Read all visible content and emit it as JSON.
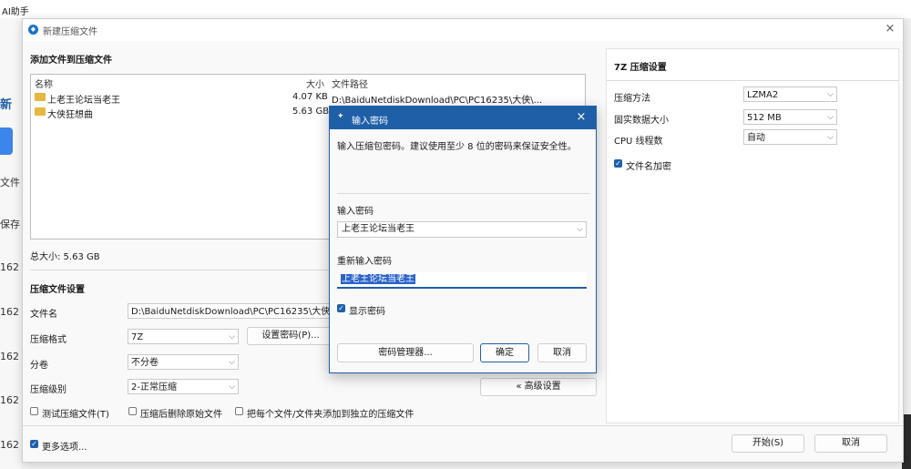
{
  "background": {
    "top_left_text": "AI助手",
    "left_texts": [
      "新",
      "文件",
      "保存",
      "162",
      "162",
      "162",
      "162",
      "162"
    ]
  },
  "window": {
    "title": "新建压缩文件",
    "close": "×",
    "add_files_label": "添加文件到压缩文件",
    "columns": {
      "name": "名称",
      "size": "大小",
      "path": "文件路径"
    },
    "files": [
      {
        "name": "上老王论坛当老王",
        "size": "4.07 KB",
        "path": "D:\\BaiduNetdiskDownload\\PC\\PC16235\\大侠\\..."
      },
      {
        "name": "大侠狂想曲",
        "size": "5.63 GB",
        "path": ""
      }
    ],
    "total_size": "总大小: 5.63 GB",
    "settings_label": "压缩文件设置",
    "filename_label": "文件名",
    "filename_value": "D:\\BaiduNetdiskDownload\\PC\\PC16235\\大侠\\大",
    "format_label": "压缩格式",
    "format_value": "7Z",
    "set_password_button": "设置密码(P)...",
    "split_label": "分卷",
    "split_value": "不分卷",
    "level_label": "压缩级别",
    "level_value": "2-正常压缩",
    "advanced_button": "« 高级设置",
    "checks": {
      "test": "测试压缩文件(T)",
      "delete": "压缩后删除原始文件",
      "each": "把每个文件/文件夹添加到独立的压缩文件",
      "more": "更多选项..."
    },
    "start_button": "开始(S)",
    "cancel_button": "取消",
    "right": {
      "header": "7Z 压缩设置",
      "method_label": "压缩方法",
      "method_value": "LZMA2",
      "solid_label": "固实数据大小",
      "solid_value": "512 MB",
      "cpu_label": "CPU 线程数",
      "cpu_value": "自动",
      "encrypt_names": "文件名加密"
    }
  },
  "dialog": {
    "title": "输入密码",
    "close": "×",
    "description": "输入压缩包密码。建议使用至少 8 位的密码来保证安全性。",
    "enter_label": "输入密码",
    "enter_value": "上老王论坛当老王",
    "reenter_label": "重新输入密码",
    "reenter_value": "上老王论坛当老王",
    "show_password": "显示密码",
    "manager_button": "密码管理器...",
    "ok_button": "确定",
    "cancel_button": "取消"
  },
  "colors": {
    "accent": "#1f5fa8",
    "folder": "#e7b740"
  }
}
